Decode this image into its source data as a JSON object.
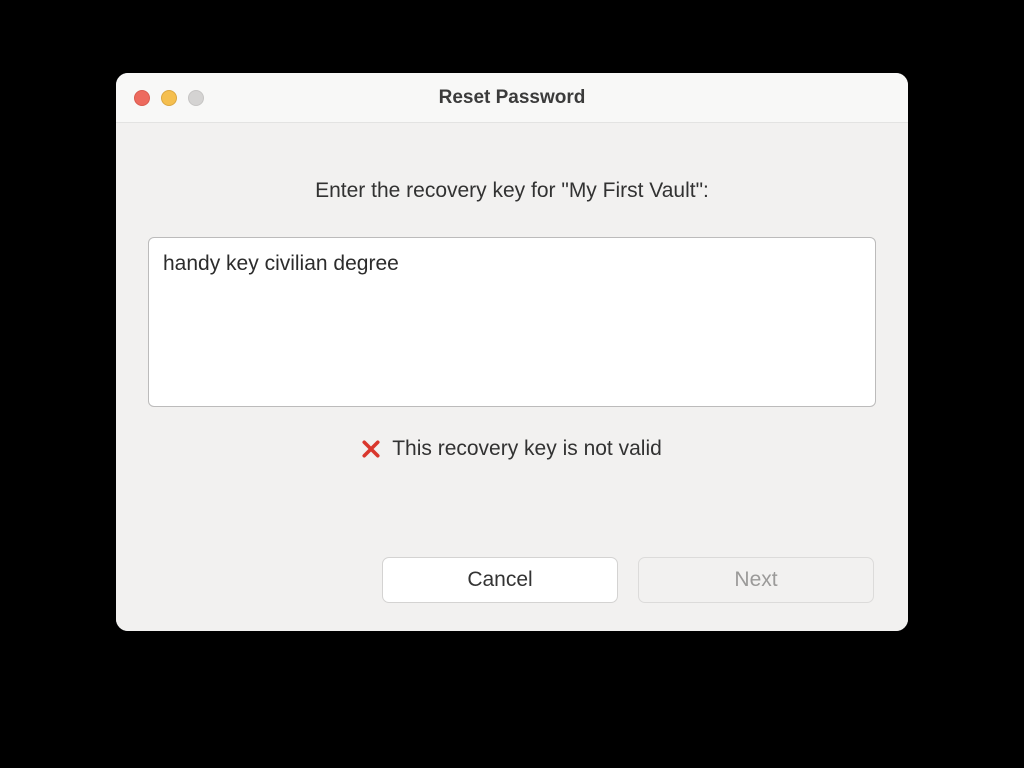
{
  "window": {
    "title": "Reset Password"
  },
  "prompt": {
    "label": "Enter the recovery key for \"My First Vault\":"
  },
  "input": {
    "value": "handy key civilian degree"
  },
  "validation": {
    "message": "This recovery key is not valid",
    "icon": "error-x-icon",
    "is_valid": false
  },
  "buttons": {
    "cancel": "Cancel",
    "next": "Next",
    "next_enabled": false
  },
  "colors": {
    "error": "#d9372d",
    "window_bg": "#f2f1f0",
    "titlebar_bg": "#f8f8f7"
  }
}
